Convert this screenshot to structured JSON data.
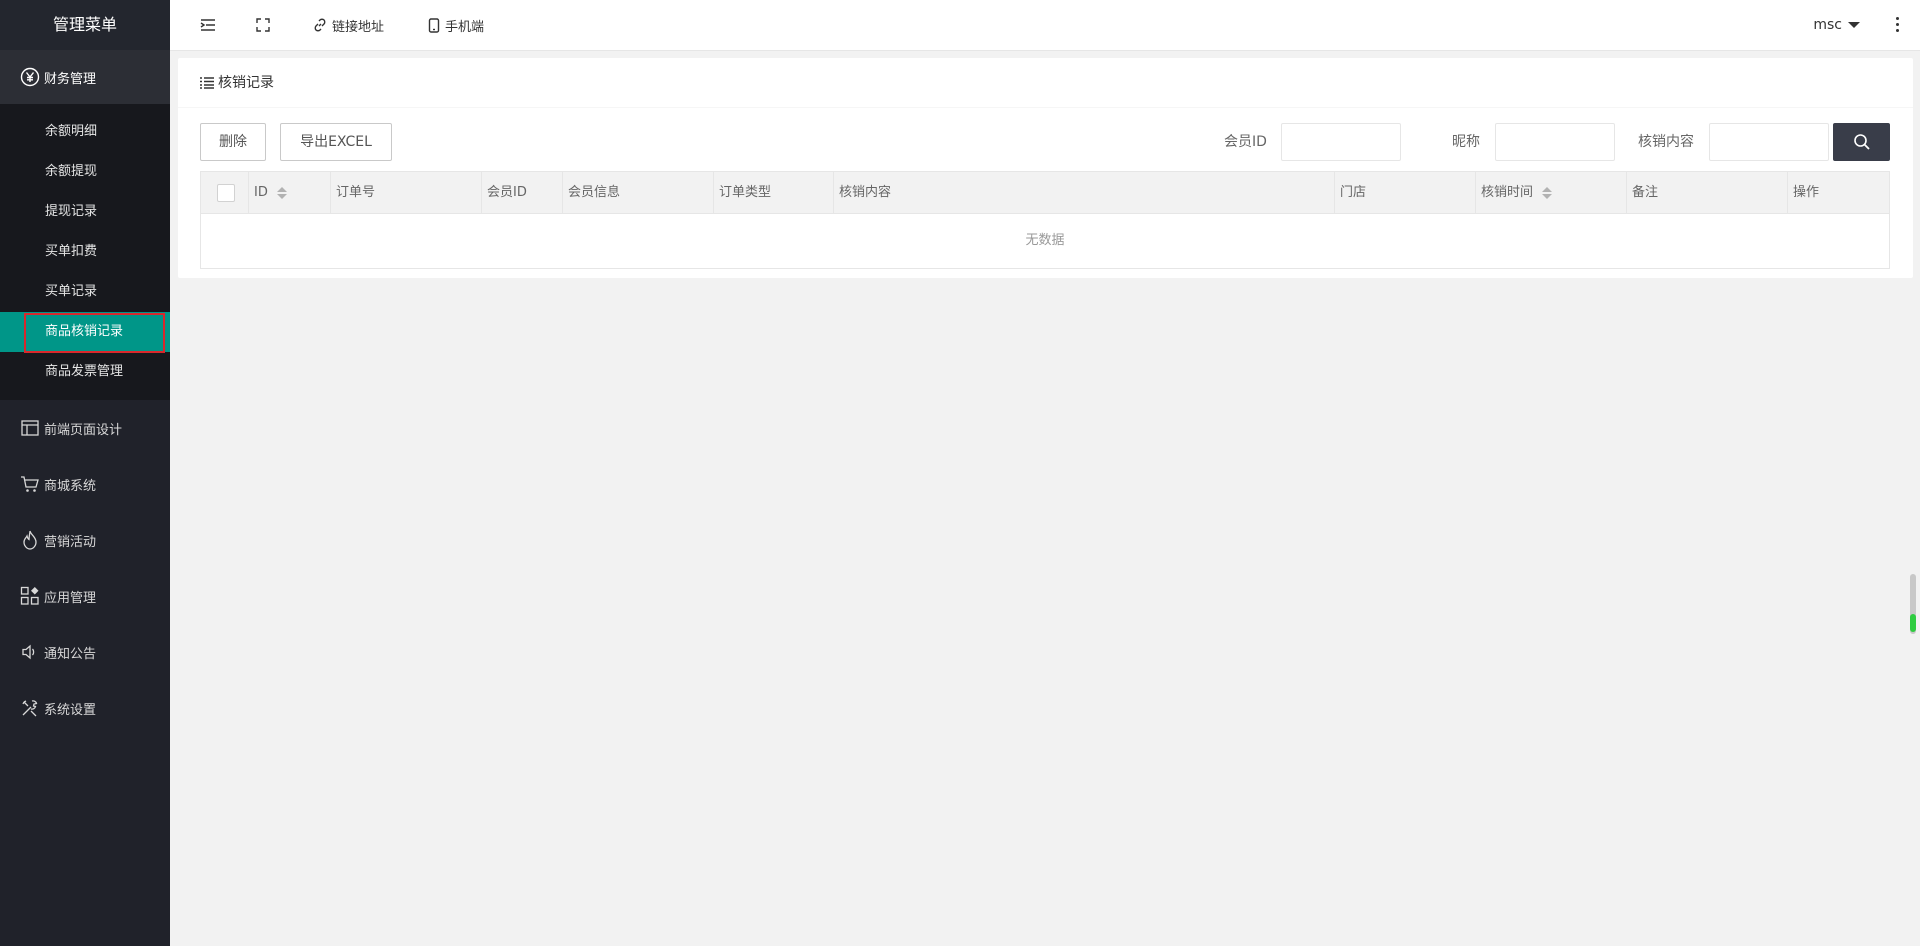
{
  "sidebar": {
    "title": "管理菜单",
    "finance": {
      "label": "财务管理",
      "items": [
        "余额明细",
        "余额提现",
        "提现记录",
        "买单扣费",
        "买单记录",
        "商品核销记录",
        "商品发票管理"
      ]
    },
    "groups": [
      {
        "label": "前端页面设计",
        "icon": "layout-icon"
      },
      {
        "label": "商城系统",
        "icon": "cart-icon"
      },
      {
        "label": "营销活动",
        "icon": "fire-icon"
      },
      {
        "label": "应用管理",
        "icon": "apps-icon"
      },
      {
        "label": "通知公告",
        "icon": "speaker-icon"
      },
      {
        "label": "系统设置",
        "icon": "tools-icon"
      }
    ]
  },
  "header": {
    "link_label": "链接地址",
    "mobile_label": "手机端",
    "user": "msc"
  },
  "card": {
    "title": "核销记录",
    "delete_label": "删除",
    "export_label": "导出EXCEL",
    "filters": {
      "member_id": "会员ID",
      "nickname": "昵称",
      "content": "核销内容"
    }
  },
  "table": {
    "columns": [
      "ID",
      "订单号",
      "会员ID",
      "会员信息",
      "订单类型",
      "核销内容",
      "门店",
      "核销时间",
      "备注",
      "操作"
    ],
    "empty": "无数据"
  },
  "colors": {
    "accent": "#009688",
    "sidebar_bg": "#20222a",
    "search_btn": "#393d49",
    "highlight_border": "#d9282c"
  }
}
